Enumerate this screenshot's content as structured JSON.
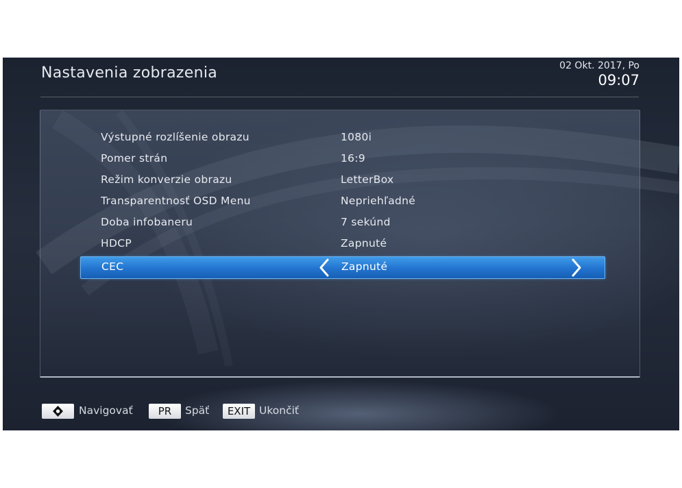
{
  "header": {
    "title": "Nastavenia zobrazenia",
    "date": "02 Okt. 2017, Po",
    "time": "09:07"
  },
  "menu": {
    "rows": [
      {
        "label": "Výstupné rozlíšenie obrazu",
        "value": "1080i"
      },
      {
        "label": "Pomer strán",
        "value": "16:9"
      },
      {
        "label": "Režim konverzie obrazu",
        "value": "LetterBox"
      },
      {
        "label": "Transparentnosť OSD Menu",
        "value": "Nepriehľadné"
      },
      {
        "label": "Doba infobaneru",
        "value": "7 sekúnd"
      },
      {
        "label": "HDCP",
        "value": "Zapnuté"
      },
      {
        "label": "CEC",
        "value": "Zapnuté",
        "selected": true
      }
    ]
  },
  "footer": {
    "navigate_icon": "navigation-diamond-icon",
    "navigate_label": "Navigovať",
    "back_key": "PR",
    "back_label": "Späť",
    "exit_key": "EXIT",
    "exit_label": "Ukončiť"
  },
  "colors": {
    "selection": "#2273cf",
    "background": "#1f2634",
    "text": "#e8ebf0"
  }
}
